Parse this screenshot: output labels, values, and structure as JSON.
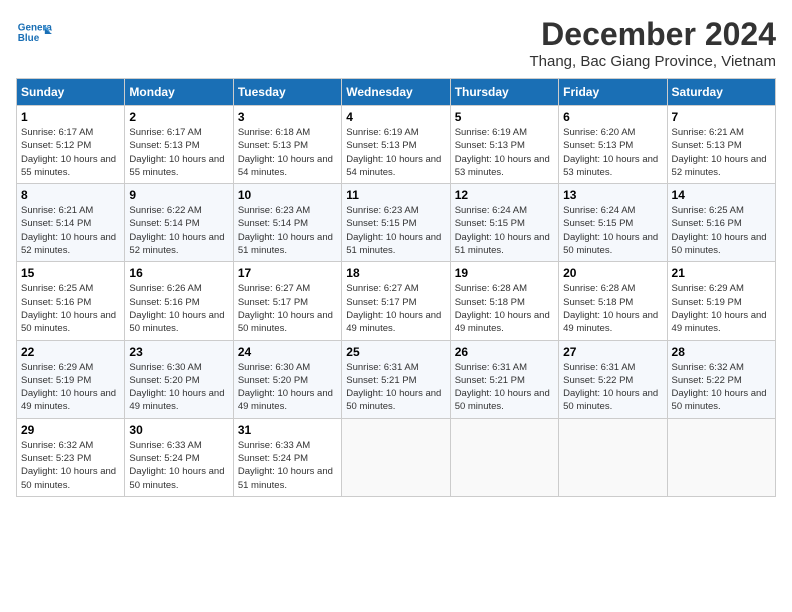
{
  "header": {
    "logo_line1": "General",
    "logo_line2": "Blue",
    "title": "December 2024",
    "subtitle": "Thang, Bac Giang Province, Vietnam"
  },
  "days_of_week": [
    "Sunday",
    "Monday",
    "Tuesday",
    "Wednesday",
    "Thursday",
    "Friday",
    "Saturday"
  ],
  "weeks": [
    [
      {
        "day": "1",
        "sunrise": "6:17 AM",
        "sunset": "5:12 PM",
        "daylight": "10 hours and 55 minutes."
      },
      {
        "day": "2",
        "sunrise": "6:17 AM",
        "sunset": "5:13 PM",
        "daylight": "10 hours and 55 minutes."
      },
      {
        "day": "3",
        "sunrise": "6:18 AM",
        "sunset": "5:13 PM",
        "daylight": "10 hours and 54 minutes."
      },
      {
        "day": "4",
        "sunrise": "6:19 AM",
        "sunset": "5:13 PM",
        "daylight": "10 hours and 54 minutes."
      },
      {
        "day": "5",
        "sunrise": "6:19 AM",
        "sunset": "5:13 PM",
        "daylight": "10 hours and 53 minutes."
      },
      {
        "day": "6",
        "sunrise": "6:20 AM",
        "sunset": "5:13 PM",
        "daylight": "10 hours and 53 minutes."
      },
      {
        "day": "7",
        "sunrise": "6:21 AM",
        "sunset": "5:13 PM",
        "daylight": "10 hours and 52 minutes."
      }
    ],
    [
      {
        "day": "8",
        "sunrise": "6:21 AM",
        "sunset": "5:14 PM",
        "daylight": "10 hours and 52 minutes."
      },
      {
        "day": "9",
        "sunrise": "6:22 AM",
        "sunset": "5:14 PM",
        "daylight": "10 hours and 52 minutes."
      },
      {
        "day": "10",
        "sunrise": "6:23 AM",
        "sunset": "5:14 PM",
        "daylight": "10 hours and 51 minutes."
      },
      {
        "day": "11",
        "sunrise": "6:23 AM",
        "sunset": "5:15 PM",
        "daylight": "10 hours and 51 minutes."
      },
      {
        "day": "12",
        "sunrise": "6:24 AM",
        "sunset": "5:15 PM",
        "daylight": "10 hours and 51 minutes."
      },
      {
        "day": "13",
        "sunrise": "6:24 AM",
        "sunset": "5:15 PM",
        "daylight": "10 hours and 50 minutes."
      },
      {
        "day": "14",
        "sunrise": "6:25 AM",
        "sunset": "5:16 PM",
        "daylight": "10 hours and 50 minutes."
      }
    ],
    [
      {
        "day": "15",
        "sunrise": "6:25 AM",
        "sunset": "5:16 PM",
        "daylight": "10 hours and 50 minutes."
      },
      {
        "day": "16",
        "sunrise": "6:26 AM",
        "sunset": "5:16 PM",
        "daylight": "10 hours and 50 minutes."
      },
      {
        "day": "17",
        "sunrise": "6:27 AM",
        "sunset": "5:17 PM",
        "daylight": "10 hours and 50 minutes."
      },
      {
        "day": "18",
        "sunrise": "6:27 AM",
        "sunset": "5:17 PM",
        "daylight": "10 hours and 49 minutes."
      },
      {
        "day": "19",
        "sunrise": "6:28 AM",
        "sunset": "5:18 PM",
        "daylight": "10 hours and 49 minutes."
      },
      {
        "day": "20",
        "sunrise": "6:28 AM",
        "sunset": "5:18 PM",
        "daylight": "10 hours and 49 minutes."
      },
      {
        "day": "21",
        "sunrise": "6:29 AM",
        "sunset": "5:19 PM",
        "daylight": "10 hours and 49 minutes."
      }
    ],
    [
      {
        "day": "22",
        "sunrise": "6:29 AM",
        "sunset": "5:19 PM",
        "daylight": "10 hours and 49 minutes."
      },
      {
        "day": "23",
        "sunrise": "6:30 AM",
        "sunset": "5:20 PM",
        "daylight": "10 hours and 49 minutes."
      },
      {
        "day": "24",
        "sunrise": "6:30 AM",
        "sunset": "5:20 PM",
        "daylight": "10 hours and 49 minutes."
      },
      {
        "day": "25",
        "sunrise": "6:31 AM",
        "sunset": "5:21 PM",
        "daylight": "10 hours and 50 minutes."
      },
      {
        "day": "26",
        "sunrise": "6:31 AM",
        "sunset": "5:21 PM",
        "daylight": "10 hours and 50 minutes."
      },
      {
        "day": "27",
        "sunrise": "6:31 AM",
        "sunset": "5:22 PM",
        "daylight": "10 hours and 50 minutes."
      },
      {
        "day": "28",
        "sunrise": "6:32 AM",
        "sunset": "5:22 PM",
        "daylight": "10 hours and 50 minutes."
      }
    ],
    [
      {
        "day": "29",
        "sunrise": "6:32 AM",
        "sunset": "5:23 PM",
        "daylight": "10 hours and 50 minutes."
      },
      {
        "day": "30",
        "sunrise": "6:33 AM",
        "sunset": "5:24 PM",
        "daylight": "10 hours and 50 minutes."
      },
      {
        "day": "31",
        "sunrise": "6:33 AM",
        "sunset": "5:24 PM",
        "daylight": "10 hours and 51 minutes."
      },
      null,
      null,
      null,
      null
    ]
  ],
  "labels": {
    "sunrise": "Sunrise:",
    "sunset": "Sunset:",
    "daylight": "Daylight:"
  }
}
